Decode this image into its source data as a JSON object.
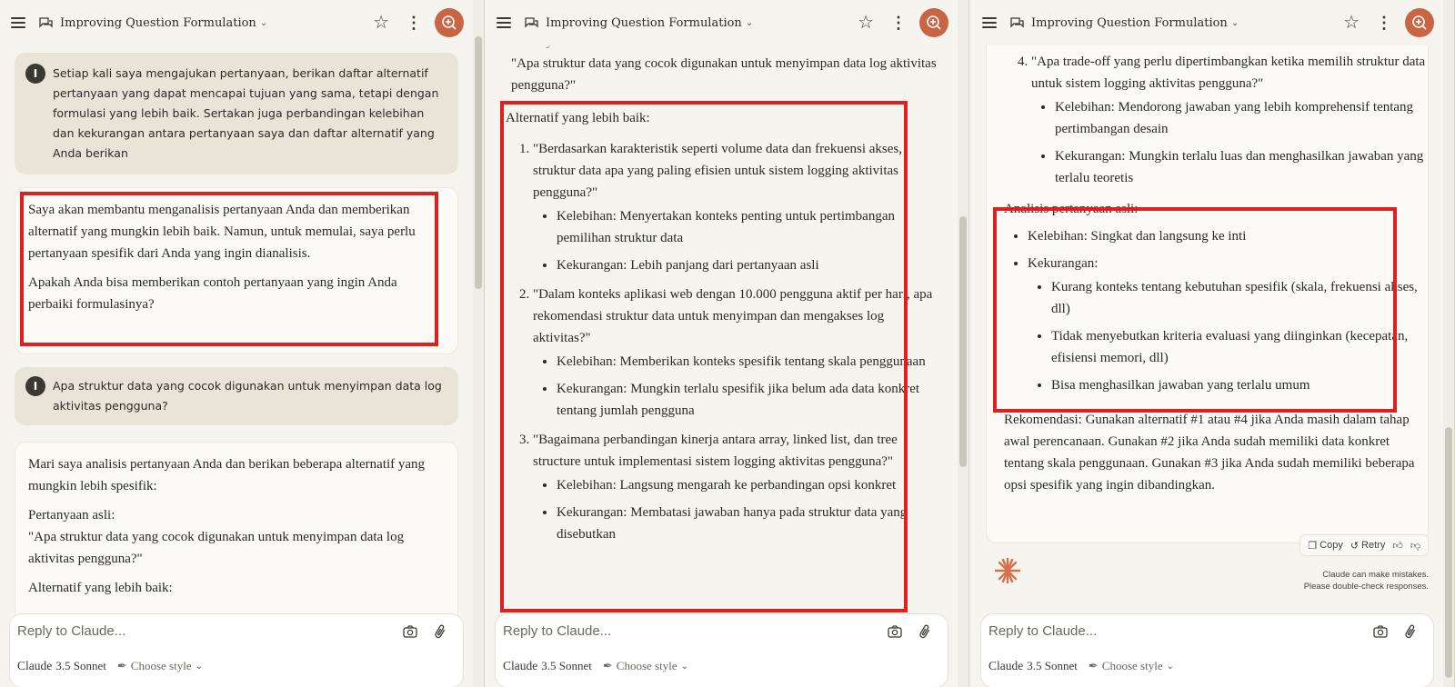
{
  "conversation_title": "Improving Question Formulation",
  "composer": {
    "placeholder": "Reply to Claude...",
    "model_name": "Claude",
    "model_version": "3.5 Sonnet",
    "choose_style": "Choose style"
  },
  "user_avatar_initial": "I",
  "panel1": {
    "user_msg_1": "Setiap kali saya mengajukan pertanyaan, berikan daftar alternatif pertanyaan yang dapat mencapai tujuan yang sama, tetapi dengan formulasi yang lebih baik. Sertakan juga perbandingan kelebihan dan kekurangan antara pertanyaan saya dan daftar alternatif yang Anda berikan",
    "assistant_reply_1": {
      "p1": "Saya akan membantu menganalisis pertanyaan Anda dan memberikan alternatif yang mungkin lebih baik. Namun, untuk memulai, saya perlu pertanyaan spesifik dari Anda yang ingin dianalisis.",
      "p2": "Apakah Anda bisa memberikan contoh pertanyaan yang ingin Anda perbaiki formulasinya?"
    },
    "user_msg_2": "Apa struktur data yang cocok digunakan untuk menyimpan data log aktivitas pengguna?",
    "assistant_reply_2": {
      "intro": "Mari saya analisis pertanyaan Anda dan berikan beberapa alternatif yang mungkin lebih spesifik:",
      "original_label": "Pertanyaan asli:",
      "original_question": "\"Apa struktur data yang cocok digunakan untuk menyimpan data log aktivitas pengguna?\"",
      "alternatives_label": "Alternatif yang lebih baik:"
    }
  },
  "panel2": {
    "original_label": "Pertanyaan asli:",
    "original_question": "\"Apa struktur data yang cocok digunakan untuk menyimpan data log aktivitas pengguna?\"",
    "alternatives_label": "Alternatif yang lebih baik:",
    "alternatives": [
      {
        "question": "\"Berdasarkan karakteristik seperti volume data dan frekuensi akses, struktur data apa yang paling efisien untuk sistem logging aktivitas pengguna?\"",
        "pro": "Kelebihan: Menyertakan konteks penting untuk pertimbangan pemilihan struktur data",
        "con": "Kekurangan: Lebih panjang dari pertanyaan asli"
      },
      {
        "question": "\"Dalam konteks aplikasi web dengan 10.000 pengguna aktif per hari, apa rekomendasi struktur data untuk menyimpan dan mengakses log aktivitas?\"",
        "pro": "Kelebihan: Memberikan konteks spesifik tentang skala penggunaan",
        "con": "Kekurangan: Mungkin terlalu spesifik jika belum ada data konkret tentang jumlah pengguna"
      },
      {
        "question": "\"Bagaimana perbandingan kinerja antara array, linked list, dan tree structure untuk implementasi sistem logging aktivitas pengguna?\"",
        "pro": "Kelebihan: Langsung mengarah ke perbandingan opsi konkret",
        "con": "Kekurangan: Membatasi jawaban hanya pada struktur data yang disebutkan"
      }
    ]
  },
  "panel3": {
    "overflow_text": "yang disebutkan",
    "alternative_4": {
      "question": "\"Apa trade-off yang perlu dipertimbangkan ketika memilih struktur data untuk sistem logging aktivitas pengguna?\"",
      "pro": "Kelebihan: Mendorong jawaban yang lebih komprehensif tentang pertimbangan desain",
      "con": "Kekurangan: Mungkin terlalu luas dan menghasilkan jawaban yang terlalu teoretis"
    },
    "analysis_label": "Analisis pertanyaan asli:",
    "analysis_pro": "Kelebihan: Singkat dan langsung ke inti",
    "analysis_con_label": "Kekurangan:",
    "analysis_cons": [
      "Kurang konteks tentang kebutuhan spesifik (skala, frekuensi akses, dll)",
      "Tidak menyebutkan kriteria evaluasi yang diinginkan (kecepatan, efisiensi memori, dll)",
      "Bisa menghasilkan jawaban yang terlalu umum"
    ],
    "recommendation": "Rekomendasi: Gunakan alternatif #1 atau #4 jika Anda masih dalam tahap awal perencanaan. Gunakan #2 jika Anda sudah memiliki data konkret tentang skala penggunaan. Gunakan #3 jika Anda sudah memiliki beberapa opsi spesifik yang ingin dibandingkan.",
    "actions": {
      "copy": "Copy",
      "retry": "Retry"
    },
    "disclaimer_line1": "Claude can make mistakes.",
    "disclaimer_line2": "Please double-check responses."
  },
  "colors": {
    "accent": "#c96542",
    "highlight_box": "#e01f1f",
    "user_bubble": "#e8e4d8",
    "background": "#f6f4ee"
  },
  "icons": [
    "menu-icon",
    "chat-icon",
    "chevron-down-icon",
    "star-icon",
    "more-vertical-icon",
    "new-chat-icon",
    "camera-icon",
    "paperclip-icon",
    "feather-icon",
    "copy-icon",
    "retry-icon",
    "thumbs-up-icon",
    "thumbs-down-icon",
    "claude-logo"
  ]
}
